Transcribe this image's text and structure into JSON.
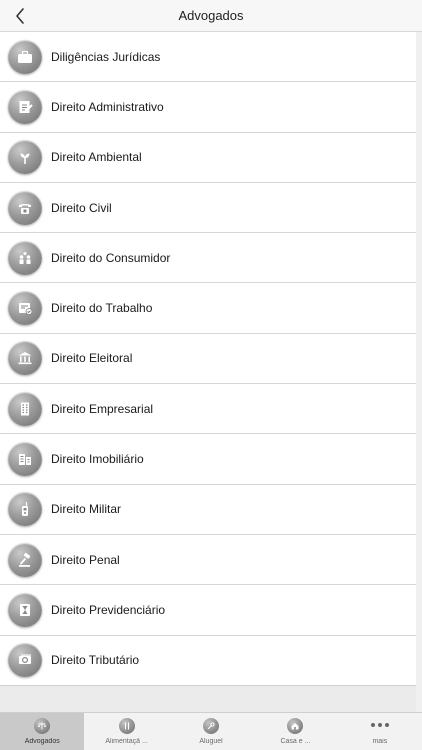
{
  "header": {
    "title": "Advogados",
    "back_icon": "chevron-left-icon"
  },
  "list": {
    "items": [
      {
        "label": "Diligências Jurídicas",
        "icon": "briefcase-icon"
      },
      {
        "label": "Direito Administrativo",
        "icon": "document-edit-icon"
      },
      {
        "label": "Direito Ambiental",
        "icon": "sprout-icon"
      },
      {
        "label": "Direito Civil",
        "icon": "telephone-icon"
      },
      {
        "label": "Direito do Consumidor",
        "icon": "people-icon"
      },
      {
        "label": "Direito do Trabalho",
        "icon": "calendar-check-icon"
      },
      {
        "label": "Direito Eleitoral",
        "icon": "institution-icon"
      },
      {
        "label": "Direito Empresarial",
        "icon": "building-icon"
      },
      {
        "label": "Direito Imobiliário",
        "icon": "buildings-icon"
      },
      {
        "label": "Direito Militar",
        "icon": "radio-icon"
      },
      {
        "label": "Direito Penal",
        "icon": "gavel-icon"
      },
      {
        "label": "Direito Previdenciário",
        "icon": "hourglass-icon"
      },
      {
        "label": "Direito Tributário",
        "icon": "money-icon"
      }
    ]
  },
  "tabbar": {
    "tabs": [
      {
        "label": "Advogados",
        "icon": "scales-icon",
        "active": true
      },
      {
        "label": "Alimentaçã ...",
        "icon": "utensils-icon",
        "active": false
      },
      {
        "label": "Aluguel",
        "icon": "key-icon",
        "active": false
      },
      {
        "label": "Casa e ...",
        "icon": "house-icon",
        "active": false
      },
      {
        "label": "mais",
        "icon": "more-dots-icon",
        "active": false
      }
    ]
  },
  "colors": {
    "tab_active_bg": "#c9c9c9",
    "icon_gray": "#8c8c8c"
  }
}
